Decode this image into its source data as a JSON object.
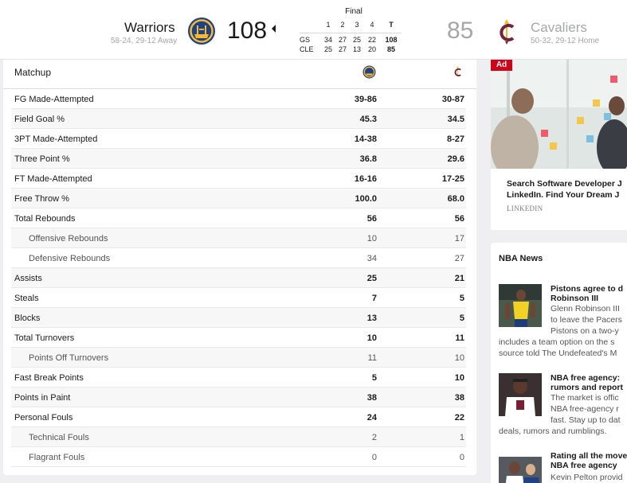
{
  "header": {
    "away": {
      "name": "Warriors",
      "record": "58-24, 29-12 Away",
      "score": "108",
      "abbr": "GS",
      "color": "#1d428a",
      "accent": "#fdb927"
    },
    "home": {
      "name": "Cavaliers",
      "record": "50-32, 29-12 Home",
      "score": "85",
      "abbr": "CLE",
      "color": "#6f263d",
      "accent": "#ffb81c"
    },
    "status": "Final",
    "linescore": {
      "periods": [
        "1",
        "2",
        "3",
        "4",
        "T"
      ],
      "rows": [
        {
          "team": "GS",
          "q": [
            "34",
            "27",
            "25",
            "22"
          ],
          "total": "108"
        },
        {
          "team": "CLE",
          "q": [
            "25",
            "27",
            "13",
            "20"
          ],
          "total": "85"
        }
      ]
    }
  },
  "stats": {
    "header_label": "Matchup",
    "rows": [
      {
        "name": "FG Made-Attempted",
        "away": "39-86",
        "home": "30-87",
        "sub": false
      },
      {
        "name": "Field Goal %",
        "away": "45.3",
        "home": "34.5",
        "sub": false
      },
      {
        "name": "3PT Made-Attempted",
        "away": "14-38",
        "home": "8-27",
        "sub": false
      },
      {
        "name": "Three Point %",
        "away": "36.8",
        "home": "29.6",
        "sub": false
      },
      {
        "name": "FT Made-Attempted",
        "away": "16-16",
        "home": "17-25",
        "sub": false
      },
      {
        "name": "Free Throw %",
        "away": "100.0",
        "home": "68.0",
        "sub": false
      },
      {
        "name": "Total Rebounds",
        "away": "56",
        "home": "56",
        "sub": false
      },
      {
        "name": "Offensive Rebounds",
        "away": "10",
        "home": "17",
        "sub": true
      },
      {
        "name": "Defensive Rebounds",
        "away": "34",
        "home": "27",
        "sub": true
      },
      {
        "name": "Assists",
        "away": "25",
        "home": "21",
        "sub": false
      },
      {
        "name": "Steals",
        "away": "7",
        "home": "5",
        "sub": false
      },
      {
        "name": "Blocks",
        "away": "13",
        "home": "5",
        "sub": false
      },
      {
        "name": "Total Turnovers",
        "away": "10",
        "home": "11",
        "sub": false
      },
      {
        "name": "Points Off Turnovers",
        "away": "11",
        "home": "10",
        "sub": true
      },
      {
        "name": "Fast Break Points",
        "away": "5",
        "home": "10",
        "sub": false
      },
      {
        "name": "Points in Paint",
        "away": "38",
        "home": "38",
        "sub": false
      },
      {
        "name": "Personal Fouls",
        "away": "24",
        "home": "22",
        "sub": false
      },
      {
        "name": "Technical Fouls",
        "away": "2",
        "home": "1",
        "sub": true
      },
      {
        "name": "Flagrant Fouls",
        "away": "0",
        "home": "0",
        "sub": true
      }
    ]
  },
  "ad": {
    "badge": "Ad",
    "line1": "Search Software Developer J",
    "line2": "LinkedIn. Find Your Dream J",
    "source": "LINKEDIN"
  },
  "news": {
    "title": "NBA News",
    "items": [
      {
        "headline": [
          "Pistons agree to d",
          "Robinson III"
        ],
        "body": [
          "Glenn Robinson III",
          "to leave the Pacers",
          "Pistons on a two-y"
        ],
        "cont": [
          "includes a team option on the s",
          "source told The Undefeated's M"
        ]
      },
      {
        "headline": [
          "NBA free agency:",
          "rumors and report"
        ],
        "body": [
          "The market is offic",
          "NBA free-agency r",
          "fast. Stay up to dat"
        ],
        "cont": [
          "deals, rumors and rumblings."
        ]
      },
      {
        "headline": [
          "Rating all the move",
          "NBA free agency"
        ],
        "body": [
          "Kevin Pelton provid"
        ],
        "cont": []
      }
    ]
  }
}
